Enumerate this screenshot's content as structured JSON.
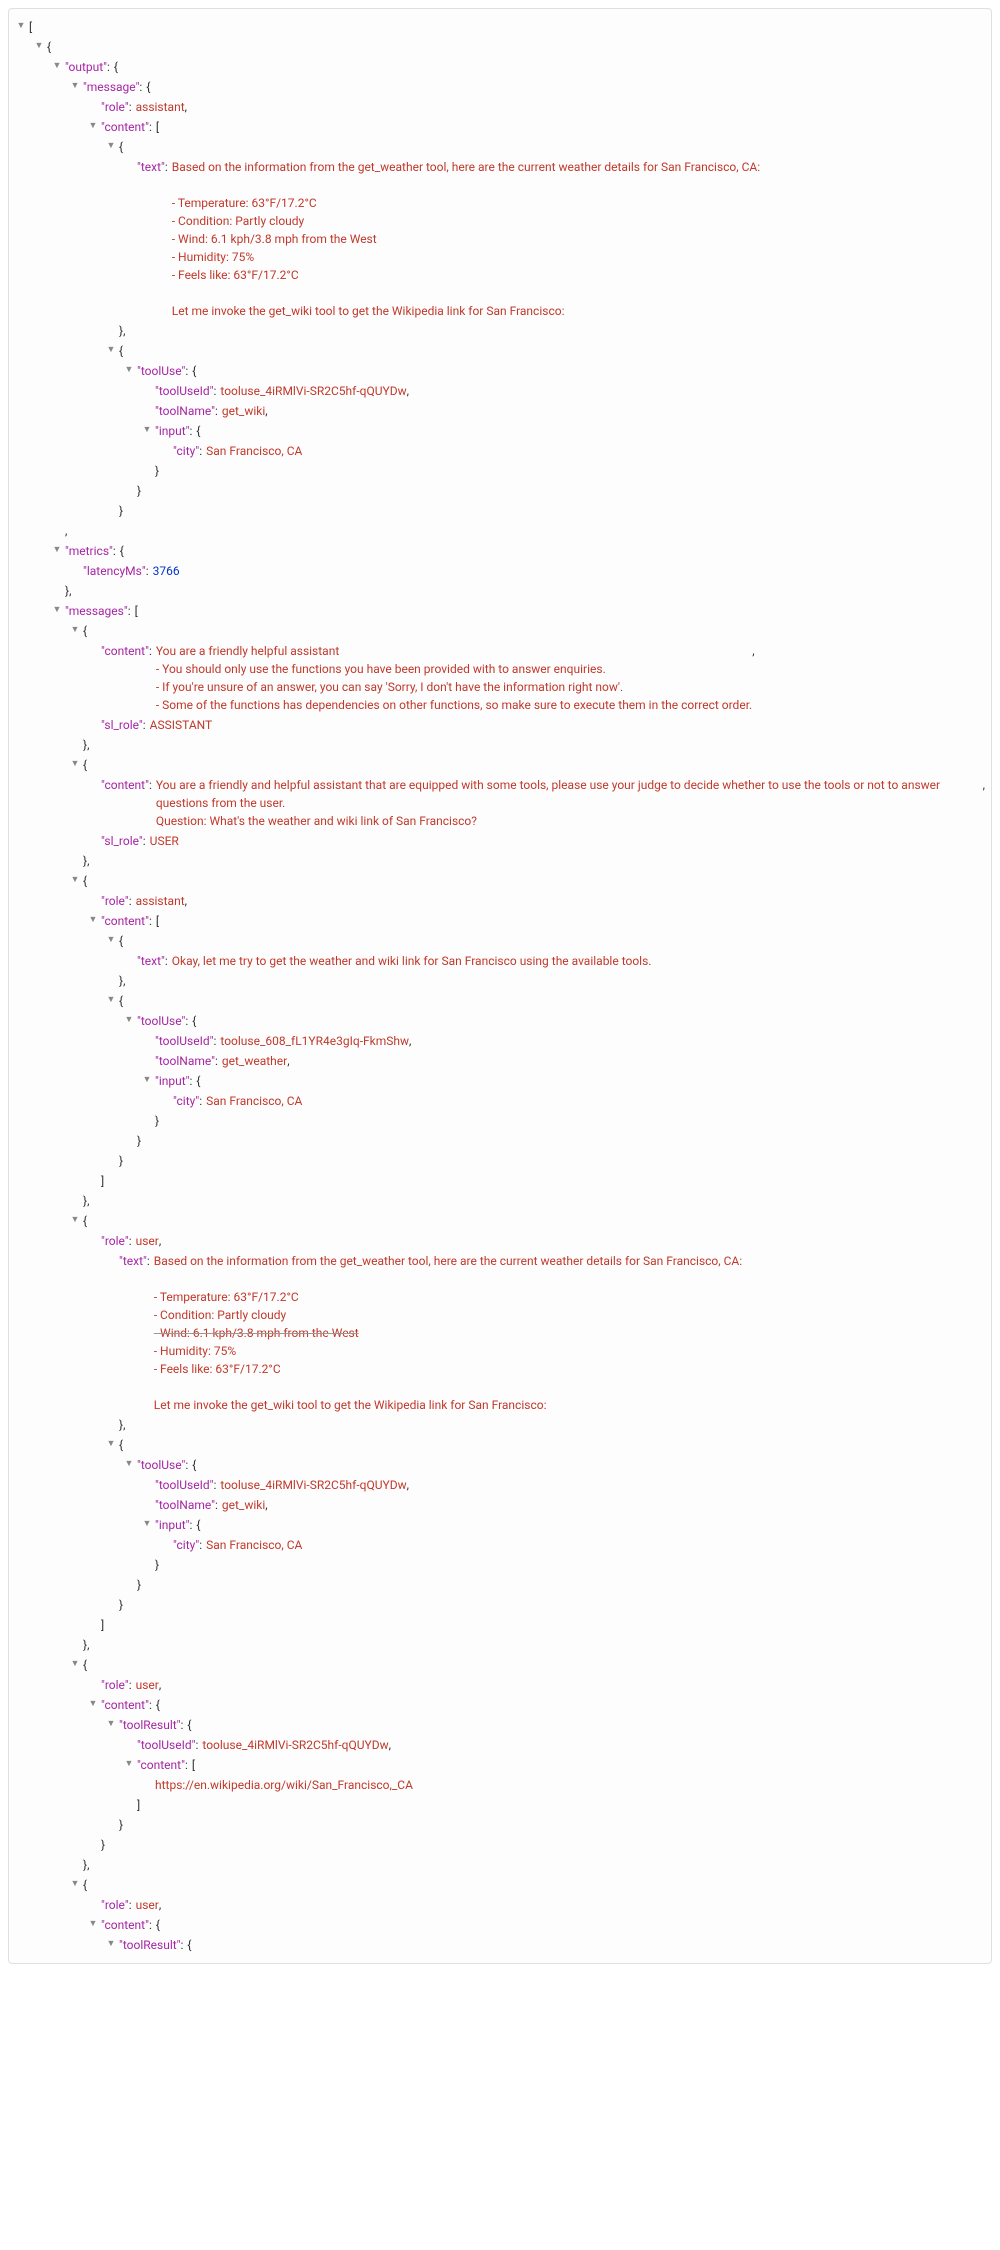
{
  "root": {
    "output": {
      "message": {
        "role": "assistant",
        "content": [
          {
            "text": "Based on the information from the get_weather tool, here are the current weather details for San Francisco, CA:\n\n- Temperature: 63°F/17.2°C\n- Condition: Partly cloudy\n- Wind: 6.1 kph/3.8 mph from the West\n- Humidity: 75%\n- Feels like: 63°F/17.2°C\n\nLet me invoke the get_wiki tool to get the Wikipedia link for San Francisco:"
          },
          {
            "toolUse": {
              "toolUseId": "tooluse_4iRMlVi-SR2C5hf-qQUYDw",
              "toolName": "get_wiki",
              "input": {
                "city": "San Francisco, CA"
              }
            }
          }
        ]
      }
    },
    "metrics": {
      "latencyMs": 3766
    },
    "messages": [
      {
        "content": "You are a friendly helpful assistant\n- You should only use the functions you have been provided with to answer enquiries.\n- If you're unsure of an answer, you can say 'Sorry, I don't have the information right now'.\n- Some of the functions has dependencies on other functions, so make sure to execute them in the correct order.",
        "sl_role": "ASSISTANT"
      },
      {
        "content": "You are a friendly and helpful assistant that are equipped with some tools, please use your judge to decide whether to use the tools or not to answer questions from the user.\nQuestion: What's the weather and wiki link of San Francisco?",
        "sl_role": "USER"
      },
      {
        "role": "assistant",
        "content": [
          {
            "text": "Okay, let me try to get the weather and wiki link for San Francisco using the available tools."
          },
          {
            "toolUse": {
              "toolUseId": "tooluse_608_fL1YR4e3gIq-FkmShw",
              "toolName": "get_weather",
              "input": {
                "city": "San Francisco, CA"
              }
            }
          }
        ]
      },
      {
        "role": "user",
        "content_items": [
          {
            "text": "Based on the information from the get_weather tool, here are the current weather details for San Francisco, CA:\n\n- Temperature: 63°F/17.2°C\n- Condition: Partly cloudy\n- Wind: 6.1 kph/3.8 mph from the West\n- Humidity: 75%\n- Feels like: 63°F/17.2°C\n\nLet me invoke the get_wiki tool to get the Wikipedia link for San Francisco:",
            "strikeLine": "- Wind: 6.1 kph/3.8 mph from the West"
          },
          {
            "toolUse": {
              "toolUseId": "tooluse_4iRMlVi-SR2C5hf-qQUYDw",
              "toolName": "get_wiki",
              "input": {
                "city": "San Francisco, CA"
              }
            }
          }
        ]
      },
      {
        "role": "user",
        "content_obj": {
          "toolResult": {
            "toolUseId": "tooluse_4iRMlVi-SR2C5hf-qQUYDw",
            "content": [
              "https://en.wikipedia.org/wiki/San_Francisco,_CA"
            ]
          }
        }
      },
      {
        "role": "user",
        "content_obj": {
          "toolResult": {}
        }
      }
    ]
  },
  "labels": {
    "output": "output",
    "message": "message",
    "role": "role",
    "content": "content",
    "text": "text",
    "toolUse": "toolUse",
    "toolUseId": "toolUseId",
    "toolName": "toolName",
    "input": "input",
    "city": "city",
    "metrics": "metrics",
    "latencyMs": "latencyMs",
    "messages": "messages",
    "sl_role": "sl_role",
    "toolResult": "toolResult"
  }
}
